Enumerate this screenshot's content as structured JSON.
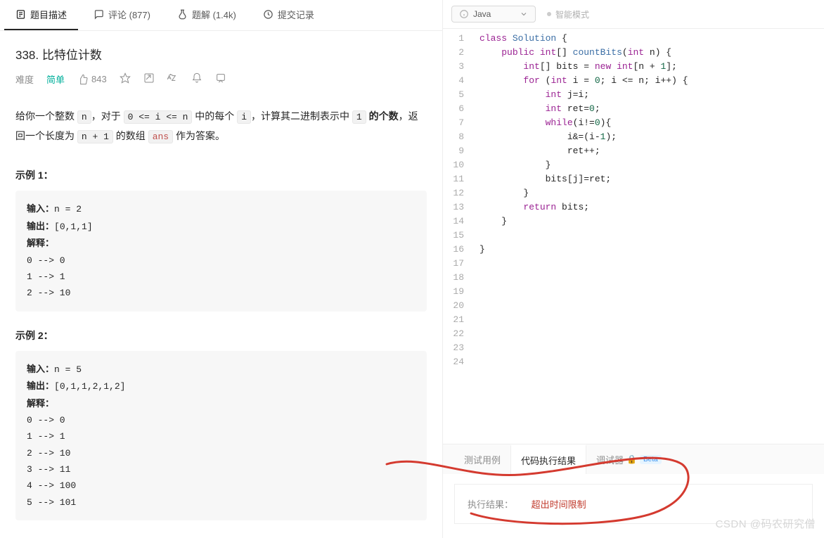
{
  "tabs": {
    "desc": "题目描述",
    "comments": "评论 (877)",
    "solutions": "题解 (1.4k)",
    "history": "提交记录"
  },
  "problem": {
    "number": "338.",
    "title": "比特位计数",
    "difficulty_label": "难度",
    "difficulty": "简单",
    "likes": "843"
  },
  "description": {
    "text_prefix": "给你一个整数 ",
    "var_n": "n",
    "text_mid1": "，对于 ",
    "range": "0 <= i <= n",
    "text_mid2": " 中的每个 ",
    "var_i": "i",
    "text_mid3": "，计算其二进制表示中 ",
    "one": "1",
    "ones_suffix": " 的个数",
    "text_line2a": "，返回一个长度为 ",
    "nplus1": "n + 1",
    "text_line2b": " 的数组 ",
    "ans": "ans",
    "text_line2c": " 作为答案。"
  },
  "examples": [
    {
      "title": "示例 1：",
      "input_label": "输入：",
      "input": "n = 2",
      "output_label": "输出：",
      "output": "[0,1,1]",
      "explain_label": "解释：",
      "explain": "0 --> 0\n1 --> 1\n2 --> 10"
    },
    {
      "title": "示例 2：",
      "input_label": "输入：",
      "input": "n = 5",
      "output_label": "输出：",
      "output": "[0,1,1,2,1,2]",
      "explain_label": "解释：",
      "explain": "0 --> 0\n1 --> 1\n2 --> 10\n3 --> 11\n4 --> 100\n5 --> 101"
    }
  ],
  "editor": {
    "language": "Java",
    "ai_mode": "智能模式",
    "total_lines": 24,
    "code_lines": [
      "class Solution {",
      "    public int[] countBits(int n) {",
      "        int[] bits = new int[n + 1];",
      "        for (int i = 0; i <= n; i++) {",
      "            int j=i;",
      "            int ret=0;",
      "            while(i!=0){",
      "                i&=(i-1);",
      "                ret++;",
      "            }",
      "            bits[j]=ret;",
      "        }",
      "        return bits;",
      "    }",
      "",
      "}",
      ""
    ]
  },
  "console": {
    "tab_testcase": "测试用例",
    "tab_result": "代码执行结果",
    "tab_debugger": "调试器",
    "beta": "Beta",
    "result_label": "执行结果：",
    "result_value": "超出时间限制"
  },
  "watermark": "CSDN @码农研究僧"
}
